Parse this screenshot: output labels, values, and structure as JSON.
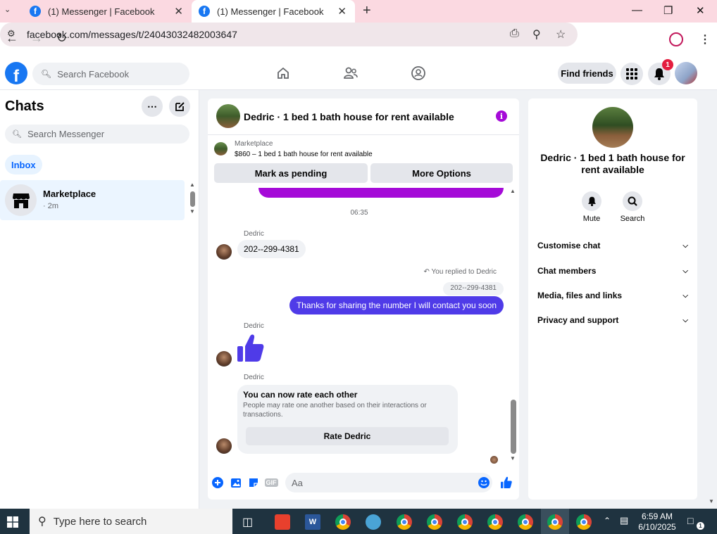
{
  "browser": {
    "tabs": [
      {
        "title": "(1) Messenger | Facebook"
      },
      {
        "title": "(1) Messenger | Facebook"
      }
    ],
    "url": "facebook.com/messages/t/24043032482003647"
  },
  "fb_header": {
    "search_placeholder": "Search Facebook",
    "find_friends": "Find friends",
    "notification_count": "1"
  },
  "sidebar": {
    "title": "Chats",
    "search_placeholder": "Search Messenger",
    "filter_chip": "Inbox",
    "chats": [
      {
        "name": "Marketplace",
        "time": "· 2m"
      }
    ]
  },
  "conversation": {
    "title": "Dedric · 1 bed 1 bath house for rent available",
    "marketplace_label": "Marketplace",
    "listing": "$860 – 1 bed 1 bath house for rent available",
    "mark_pending": "Mark as pending",
    "more_options": "More Options",
    "messages": {
      "time_separator": "06:35",
      "sender1": "Dedric",
      "msg1": "202--299-4381",
      "replied_label": "You replied to Dedric",
      "quoted": "202--299-4381",
      "outgoing": "Thanks for sharing the number I will contact you soon",
      "sender2": "Dedric",
      "sender3": "Dedric",
      "rate_title": "You can now rate each other",
      "rate_desc": "People may rate one another based on their interactions or transactions.",
      "rate_button": "Rate Dedric"
    },
    "composer_placeholder": "Aa"
  },
  "info_panel": {
    "name": "Dedric · 1 bed 1 bath house for rent available",
    "actions": [
      {
        "label": "Mute",
        "icon": "bell-icon"
      },
      {
        "label": "Search",
        "icon": "search-icon"
      }
    ],
    "sections": [
      "Customise chat",
      "Chat members",
      "Media, files and links",
      "Privacy and support"
    ]
  },
  "taskbar": {
    "search_placeholder": "Type here to search",
    "time": "6:59 AM",
    "date": "6/10/2025",
    "notification_count": "1"
  },
  "colors": {
    "fb_blue": "#1877f2",
    "outgoing_bubble": "#4f3be8",
    "purple_accent": "#a50ad8",
    "tabstrip": "#fbd9e1"
  }
}
